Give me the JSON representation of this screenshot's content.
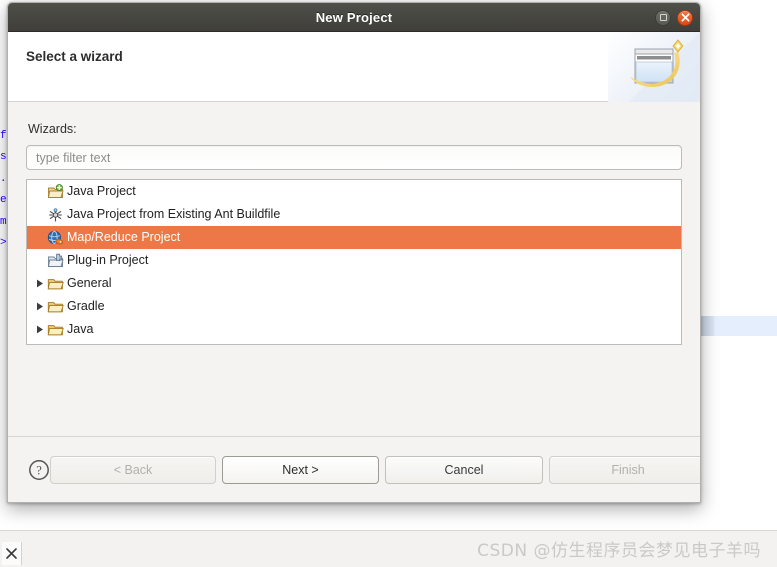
{
  "window": {
    "title": "New Project",
    "maximize_icon": "maximize-icon",
    "close_icon": "close-icon"
  },
  "banner": {
    "title": "Select a wizard",
    "art_icon": "new-project-wizard-banner-icon"
  },
  "form": {
    "wizards_label": "Wizards:",
    "filter_placeholder": "type filter text",
    "filter_value": ""
  },
  "tree": {
    "items": [
      {
        "label": "Java Project",
        "icon": "java-project-icon",
        "indent": 0,
        "expandable": false,
        "selected": false
      },
      {
        "label": "Java Project from Existing Ant Buildfile",
        "icon": "ant-buildfile-icon",
        "indent": 0,
        "expandable": false,
        "selected": false
      },
      {
        "label": "Map/Reduce Project",
        "icon": "map-reduce-project-icon",
        "indent": 0,
        "expandable": false,
        "selected": true
      },
      {
        "label": "Plug-in Project",
        "icon": "plugin-project-icon",
        "indent": 0,
        "expandable": false,
        "selected": false
      },
      {
        "label": "General",
        "icon": "folder-icon",
        "indent": 0,
        "expandable": true,
        "selected": false
      },
      {
        "label": "Gradle",
        "icon": "folder-icon",
        "indent": 0,
        "expandable": true,
        "selected": false
      },
      {
        "label": "Java",
        "icon": "folder-icon",
        "indent": 0,
        "expandable": true,
        "selected": false
      }
    ]
  },
  "footer": {
    "help_icon": "help-question-icon",
    "back_label": "< Back",
    "next_label": "Next >",
    "cancel_label": "Cancel",
    "finish_label": "Finish"
  },
  "background": {
    "code_fragment": "f\ns\n.\ne\nm\n>",
    "watermark": "CSDN @仿生程序员会梦见电子羊吗",
    "tab_close_icon": "close-icon"
  },
  "colors": {
    "selection": "#ED7746",
    "titlebar": "#474742",
    "close_button": "#DD4814",
    "background_row_highlight": "#E5EEFC"
  }
}
